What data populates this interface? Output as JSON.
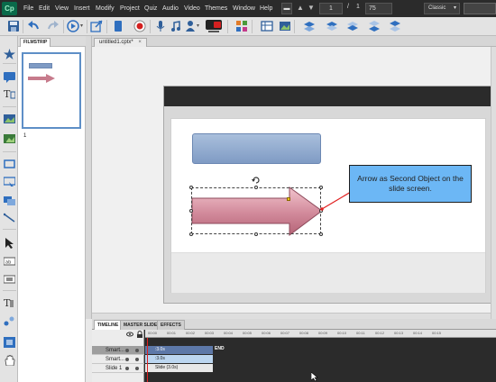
{
  "app": {
    "logo": "Cp",
    "menus": [
      "File",
      "Edit",
      "View",
      "Insert",
      "Modify",
      "Project",
      "Quiz",
      "Audio",
      "Video",
      "Themes",
      "Window",
      "Help"
    ],
    "slide_current": "1",
    "slide_separator": "/",
    "slide_total": "1",
    "zoom": "75",
    "workspace": "Classic"
  },
  "filmstrip": {
    "tab_label": "FILMSTRIP",
    "slides": [
      {
        "number": "1"
      }
    ]
  },
  "document": {
    "tab_label": "untitled1.cptx*"
  },
  "slide": {
    "callout_text": "Arrow as Second Object on the slide screen."
  },
  "timeline": {
    "tabs": [
      "TIMELINE",
      "MASTER SLIDE",
      "EFFECTS"
    ],
    "ticks": [
      "00:00",
      "00:01",
      "00:02",
      "00:03",
      "00:04",
      "00:05",
      "00:06",
      "00:07",
      "00:08",
      "00:09",
      "00:10",
      "00:11",
      "00:12",
      "00:13",
      "00:14",
      "00:15"
    ],
    "rows": [
      {
        "name": "Smart...",
        "bar_label": ":3.0s",
        "end_label": "END"
      },
      {
        "name": "Smart...",
        "bar_label": ":3.0s"
      },
      {
        "name": "Slide 1",
        "bar_label": "Slide (3.0s)"
      }
    ]
  },
  "colors": {
    "accent_blue": "#6cb7f5",
    "arrow_pink": "#c77b8c",
    "playhead_red": "#e02020"
  }
}
